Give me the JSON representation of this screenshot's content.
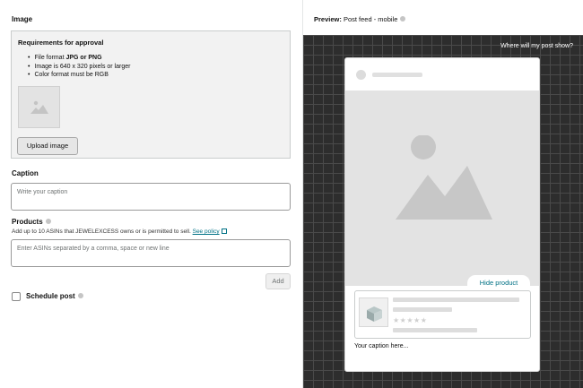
{
  "image_section": {
    "title": "Image",
    "requirements_title": "Requirements for approval",
    "req_1_prefix": "File format ",
    "req_1_bold": "JPG or PNG",
    "req_2": "Image is 640 x 320 pixels or larger",
    "req_3": "Color format must be RGB",
    "upload_label": "Upload image"
  },
  "caption_section": {
    "title": "Caption",
    "placeholder": "Write your caption"
  },
  "products_section": {
    "title": "Products",
    "subtitle": "Add up to 10 ASINs that JEWELEXCESS owns or is permitted to sell.",
    "policy_link": "See policy",
    "placeholder": "Enter ASINs separated by a comma, space or new line",
    "add_label": "Add"
  },
  "schedule": {
    "label": "Schedule post"
  },
  "preview": {
    "label_bold": "Preview:",
    "label_rest": "Post feed - mobile",
    "where_label": "Where will my post show?",
    "hide_product_label": "Hide product",
    "caption_text": "Your caption here...",
    "stars": "★★★★★"
  },
  "colors": {
    "link": "#007185",
    "grid_background": "#2d2d2d"
  }
}
